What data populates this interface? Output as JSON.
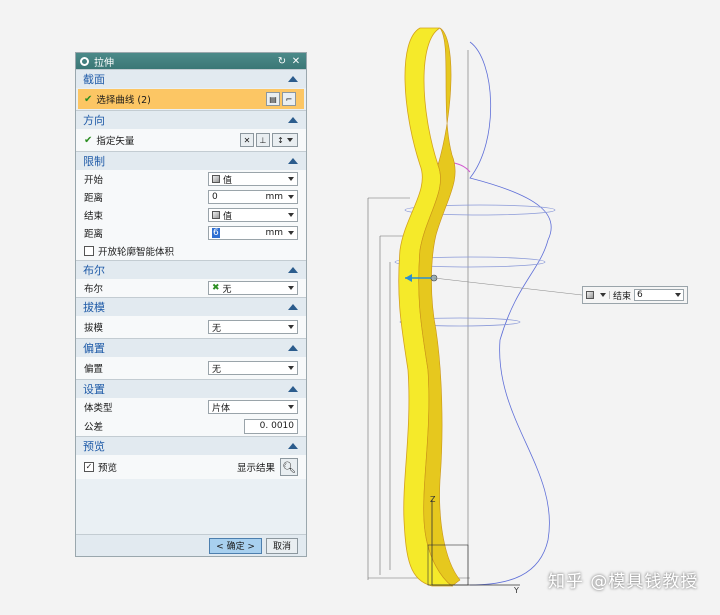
{
  "dialog": {
    "title": "拉伸",
    "sections": {
      "section": {
        "header": "截面",
        "select_curve": "选择曲线 (2)"
      },
      "direction": {
        "header": "方向",
        "vector": "指定矢量"
      },
      "limits": {
        "header": "限制",
        "start_label": "开始",
        "start_value": "值",
        "distance1_label": "距离",
        "distance1_value": "0",
        "distance1_unit": "mm",
        "end_label": "结束",
        "end_value": "值",
        "distance2_label": "距离",
        "distance2_value": "6",
        "distance2_unit": "mm",
        "open_profile": "开放轮廓智能体积"
      },
      "boolean": {
        "header": "布尔",
        "label": "布尔",
        "value": "无"
      },
      "draft": {
        "header": "拔模",
        "label": "拔模",
        "value": "无"
      },
      "offset": {
        "header": "偏置",
        "label": "偏置",
        "value": "无"
      },
      "settings": {
        "header": "设置",
        "body_type_label": "体类型",
        "body_type_value": "片体",
        "tolerance_label": "公差",
        "tolerance_value": "0. 0010"
      },
      "preview": {
        "header": "预览",
        "preview_label": "预览",
        "show_result": "显示结果"
      }
    },
    "buttons": {
      "ok": "< 确定 >",
      "cancel": "取消"
    }
  },
  "floater": {
    "label": "结束",
    "value": "6"
  },
  "viewport": {
    "axis_z": "Z",
    "axis_y": "Y"
  },
  "watermark": "知乎 @模具钱教授",
  "colors": {
    "titlebar": "#3b7776",
    "section_header": "#1f5ba8",
    "highlight_row": "#fcc664",
    "model_yellow": "#f5ea2a",
    "wire_blue": "#3a5fd0"
  }
}
